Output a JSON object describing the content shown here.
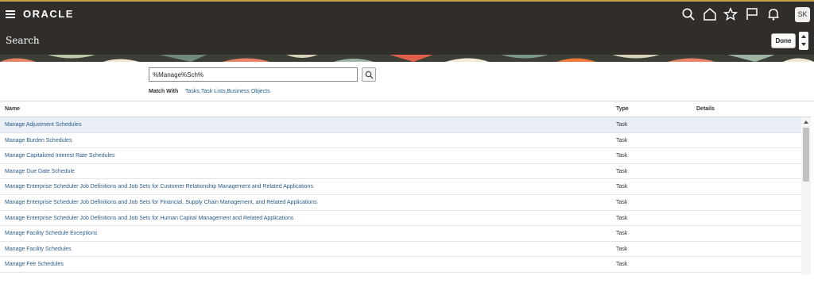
{
  "header": {
    "logo": "ORACLE",
    "avatar_initials": "SK",
    "icons": [
      "search-icon",
      "home-icon",
      "star-icon",
      "flag-icon",
      "bell-icon"
    ]
  },
  "titlebar": {
    "title": "Search",
    "done_label": "Done"
  },
  "search": {
    "value": "%Manage%Sch%",
    "match_with_label": "Match With",
    "match_with_value": "Tasks,Task Lists,Business Objects"
  },
  "table": {
    "columns": {
      "name": "Name",
      "type": "Type",
      "details": "Details"
    },
    "rows": [
      {
        "name": "Manage Adjustment Schedules",
        "type": "Task"
      },
      {
        "name": "Manage Burden Schedules",
        "type": "Task"
      },
      {
        "name": "Manage Capitalized Interest Rate Schedules",
        "type": "Task"
      },
      {
        "name": "Manage Due Date Schedule",
        "type": "Task"
      },
      {
        "name": "Manage Enterprise Scheduler Job Definitions and Job Sets for Customer Relationship Management and Related Applications",
        "type": "Task"
      },
      {
        "name": "Manage Enterprise Scheduler Job Definitions and Job Sets for Financial, Supply Chain Management, and Related Applications",
        "type": "Task"
      },
      {
        "name": "Manage Enterprise Scheduler Job Definitions and Job Sets for Human Capital Management and Related Applications",
        "type": "Task"
      },
      {
        "name": "Manage Facility Schedule Exceptions",
        "type": "Task"
      },
      {
        "name": "Manage Facility Schedules",
        "type": "Task"
      },
      {
        "name": "Manage Fee Schedules",
        "type": "Task"
      }
    ],
    "selected_row": 0
  },
  "colors": {
    "header_bg": "#312d2a",
    "link": "#2a5c8a",
    "selected_row": "#e9eff5"
  }
}
